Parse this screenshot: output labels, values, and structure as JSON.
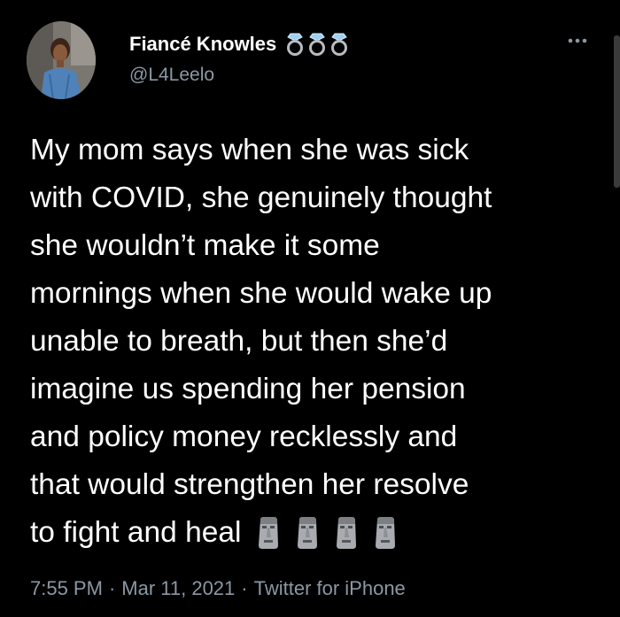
{
  "tweet": {
    "author": {
      "display_name": "Fiancé Knowles",
      "handle": "@L4Leelo",
      "badges": [
        "ring-icon",
        "ring-icon",
        "ring-icon"
      ]
    },
    "more_icon": "more-icon",
    "body_lines": [
      "My mom says when she was sick",
      "with COVID, she genuinely thought",
      "she wouldn’t make it some",
      "mornings when she would wake up",
      "unable to breath, but then she’d",
      "imagine us spending her pension",
      "and policy money recklessly and",
      "that would strengthen her resolve",
      "to fight and heal"
    ],
    "trailing_emojis": [
      "moai-icon",
      "moai-icon",
      "moai-icon",
      "moai-icon"
    ],
    "meta": {
      "time": "7:55 PM",
      "separator": "·",
      "date": "Mar 11, 2021",
      "source": "Twitter for iPhone"
    }
  },
  "colors": {
    "background": "#000000",
    "primary_text": "#ffffff",
    "secondary_text": "#8b98a5"
  }
}
